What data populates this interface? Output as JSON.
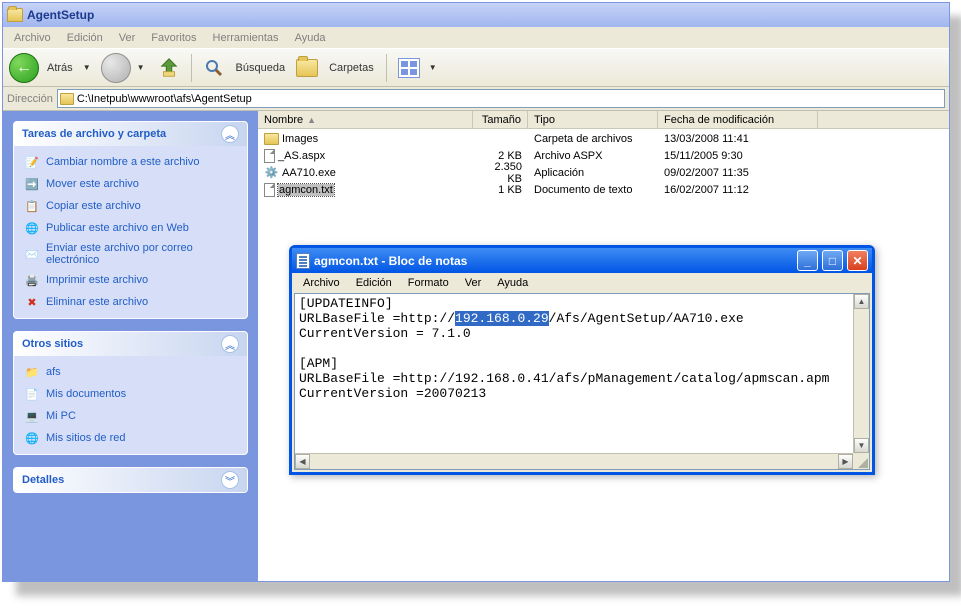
{
  "explorer": {
    "title": "AgentSetup",
    "menu": {
      "file": "Archivo",
      "edit": "Edición",
      "view": "Ver",
      "favorites": "Favoritos",
      "tools": "Herramientas",
      "help": "Ayuda"
    },
    "toolbar": {
      "back": "Atrás",
      "search": "Búsqueda",
      "folders": "Carpetas"
    },
    "address": {
      "label": "Dirección",
      "path": "C:\\Inetpub\\wwwroot\\afs\\AgentSetup"
    },
    "columns": {
      "name": "Nombre",
      "size": "Tamaño",
      "type": "Tipo",
      "date": "Fecha de modificación"
    },
    "files": [
      {
        "name": "Images",
        "size": "",
        "type": "Carpeta de archivos",
        "date": "13/03/2008 11:41",
        "icon": "folder"
      },
      {
        "name": "_AS.aspx",
        "size": "2 KB",
        "type": "Archivo ASPX",
        "date": "15/11/2005 9:30",
        "icon": "page"
      },
      {
        "name": "AA710.exe",
        "size": "2.350 KB",
        "type": "Aplicación",
        "date": "09/02/2007 11:35",
        "icon": "exe"
      },
      {
        "name": "agmcon.txt",
        "size": "1 KB",
        "type": "Documento de texto",
        "date": "16/02/2007 11:12",
        "icon": "txt"
      }
    ],
    "tasks": {
      "header": "Tareas de archivo y carpeta",
      "items": [
        "Cambiar nombre a este archivo",
        "Mover este archivo",
        "Copiar este archivo",
        "Publicar este archivo en Web",
        "Enviar este archivo por correo electrónico",
        "Imprimir este archivo",
        "Eliminar este archivo"
      ]
    },
    "places": {
      "header": "Otros sitios",
      "items": [
        "afs",
        "Mis documentos",
        "Mi PC",
        "Mis sitios de red"
      ]
    },
    "details": {
      "header": "Detalles"
    }
  },
  "notepad": {
    "title": "agmcon.txt - Bloc de notas",
    "menu": {
      "file": "Archivo",
      "edit": "Edición",
      "format": "Formato",
      "view": "Ver",
      "help": "Ayuda"
    },
    "content": {
      "line1": "[UPDATEINFO]",
      "line2a": "URLBaseFile =http://",
      "line2_highlight": "192.168.0.29",
      "line2b": "/Afs/AgentSetup/AA710.exe",
      "line3": "CurrentVersion = 7.1.0",
      "line4": "",
      "line5": "[APM]",
      "line6": "URLBaseFile =http://192.168.0.41/afs/pManagement/catalog/apmscan.apm",
      "line7": "CurrentVersion =20070213"
    }
  }
}
